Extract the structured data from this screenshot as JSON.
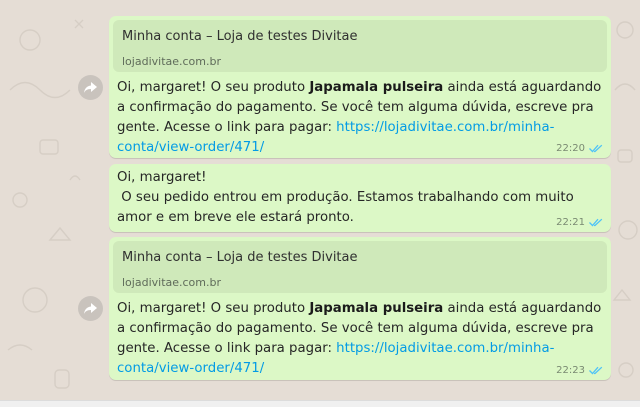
{
  "messages": [
    {
      "preview": {
        "title": "Minha conta – Loja de testes Divitae",
        "domain": "lojadivitae.com.br"
      },
      "text_before": "Oi, margaret! O seu produto ",
      "bold": "Japamala pulseira",
      "text_after": " ainda está aguardando a confirmação do pagamento. Se você tem alguma dúvida, escreve pra gente. Acesse o link para pagar: ",
      "link": "https://lojadivitae.com.br/minha-conta/view-order/471/",
      "time": "22:20",
      "status_icon": "double-check-blue-icon"
    },
    {
      "text": "Oi, margaret!\n O seu pedido entrou em produção. Estamos trabalhando com muito amor e em breve ele estará pronto.",
      "time": "22:21",
      "status_icon": "double-check-blue-icon"
    },
    {
      "preview": {
        "title": "Minha conta – Loja de testes Divitae",
        "domain": "lojadivitae.com.br"
      },
      "text_before": "Oi, margaret! O seu produto ",
      "bold": "Japamala pulseira",
      "text_after": " ainda está aguardando a confirmação do pagamento. Se você tem alguma dúvida, escreve pra gente. Acesse o link para pagar: ",
      "link": "https://lojadivitae.com.br/minha-conta/view-order/471/",
      "time": "22:23",
      "status_icon": "double-check-blue-icon"
    }
  ],
  "colors": {
    "background": "#e5ddd5",
    "bubble": "#dcf8c6",
    "preview_bg": "#cfe9ba",
    "link": "#039be5",
    "ticks": "#4fc3f7"
  },
  "icons": {
    "forward": "forward-arrow-icon"
  }
}
